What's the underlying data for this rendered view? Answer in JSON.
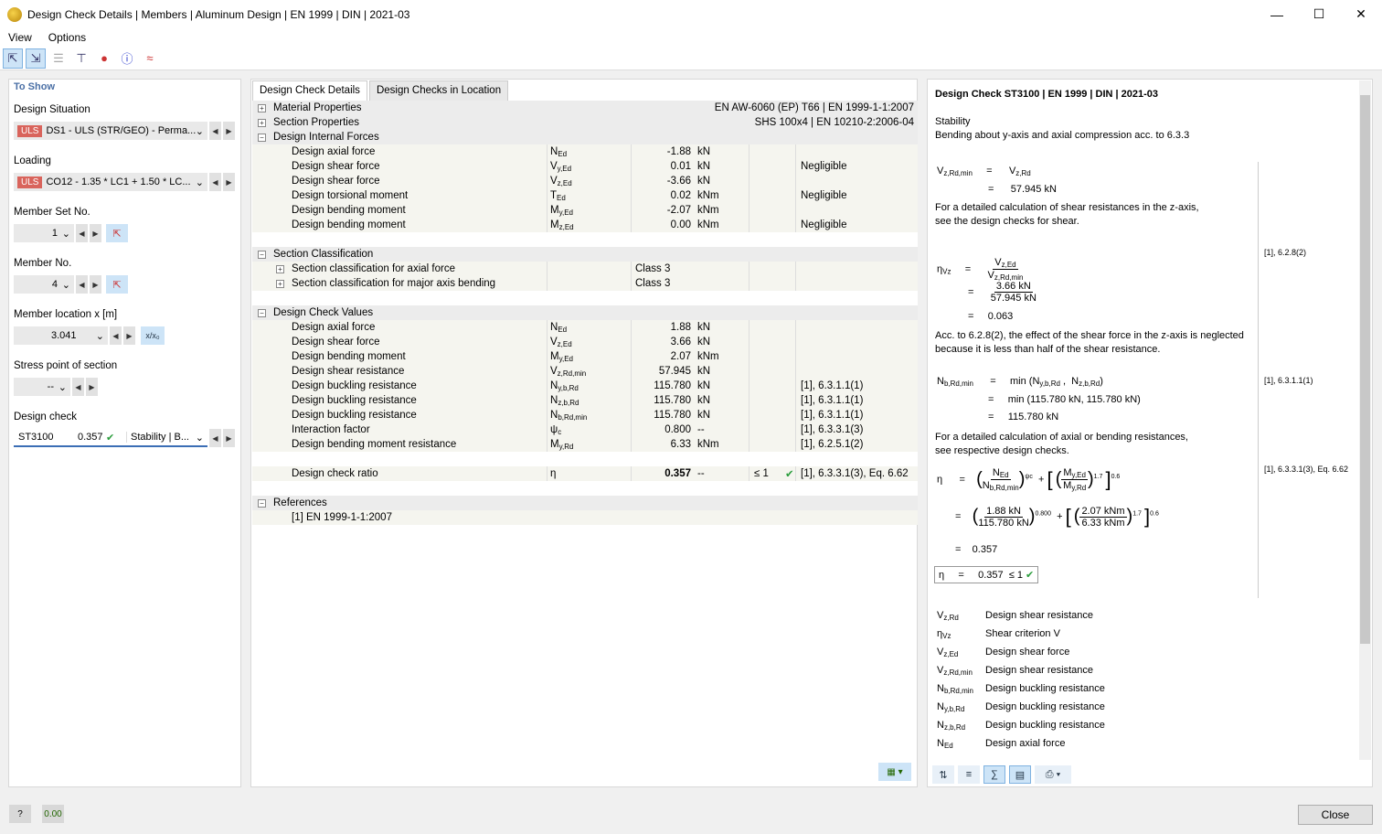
{
  "window": {
    "title": "Design Check Details | Members | Aluminum Design | EN 1999 | DIN | 2021-03"
  },
  "menu": [
    "View",
    "Options"
  ],
  "left": {
    "heading": "To Show",
    "design_situation": {
      "label": "Design Situation",
      "badge": "ULS",
      "value": "DS1 - ULS (STR/GEO) - Perma..."
    },
    "loading": {
      "label": "Loading",
      "badge": "ULS",
      "value": "CO12 - 1.35 * LC1 + 1.50 * LC..."
    },
    "member_set": {
      "label": "Member Set No.",
      "value": "1"
    },
    "member_no": {
      "label": "Member No.",
      "value": "4"
    },
    "location": {
      "label": "Member location x [m]",
      "value": "3.041",
      "btn": "x/x₀"
    },
    "stress_point": {
      "label": "Stress point of section",
      "value": "--"
    },
    "design_check": {
      "label": "Design check",
      "id": "ST3100",
      "ratio": "0.357",
      "type": "Stability | B..."
    }
  },
  "tabs": [
    "Design Check Details",
    "Design Checks in Location"
  ],
  "groups": {
    "material": {
      "name": "Material Properties",
      "value": "EN AW-6060 (EP) T66 | EN 1999-1-1:2007"
    },
    "section": {
      "name": "Section Properties",
      "value": "SHS 100x4 | EN 10210-2:2006-04"
    },
    "internal_forces": "Design Internal Forces",
    "classification": "Section Classification",
    "check_values": "Design Check Values",
    "references": "References"
  },
  "internal_forces": [
    {
      "name": "Design axial force",
      "sym": "N",
      "sub": "Ed",
      "val": "-1.88",
      "unit": "kN",
      "note": ""
    },
    {
      "name": "Design shear force",
      "sym": "V",
      "sub": "y,Ed",
      "val": "0.01",
      "unit": "kN",
      "note": "Negligible"
    },
    {
      "name": "Design shear force",
      "sym": "V",
      "sub": "z,Ed",
      "val": "-3.66",
      "unit": "kN",
      "note": ""
    },
    {
      "name": "Design torsional moment",
      "sym": "T",
      "sub": "Ed",
      "val": "0.02",
      "unit": "kNm",
      "note": "Negligible"
    },
    {
      "name": "Design bending moment",
      "sym": "M",
      "sub": "y,Ed",
      "val": "-2.07",
      "unit": "kNm",
      "note": ""
    },
    {
      "name": "Design bending moment",
      "sym": "M",
      "sub": "z,Ed",
      "val": "0.00",
      "unit": "kNm",
      "note": "Negligible"
    }
  ],
  "classification": [
    {
      "name": "Section classification for axial force",
      "val": "Class 3"
    },
    {
      "name": "Section classification for major axis bending",
      "val": "Class 3"
    }
  ],
  "check_values": [
    {
      "name": "Design axial force",
      "sym": "N",
      "sub": "Ed",
      "val": "1.88",
      "unit": "kN",
      "ref": ""
    },
    {
      "name": "Design shear force",
      "sym": "V",
      "sub": "z,Ed",
      "val": "3.66",
      "unit": "kN",
      "ref": ""
    },
    {
      "name": "Design bending moment",
      "sym": "M",
      "sub": "y,Ed",
      "val": "2.07",
      "unit": "kNm",
      "ref": ""
    },
    {
      "name": "Design shear resistance",
      "sym": "V",
      "sub": "z,Rd,min",
      "val": "57.945",
      "unit": "kN",
      "ref": ""
    },
    {
      "name": "Design buckling resistance",
      "sym": "N",
      "sub": "y,b,Rd",
      "val": "115.780",
      "unit": "kN",
      "ref": "[1], 6.3.1.1(1)"
    },
    {
      "name": "Design buckling resistance",
      "sym": "N",
      "sub": "z,b,Rd",
      "val": "115.780",
      "unit": "kN",
      "ref": "[1], 6.3.1.1(1)"
    },
    {
      "name": "Design buckling resistance",
      "sym": "N",
      "sub": "b,Rd,min",
      "val": "115.780",
      "unit": "kN",
      "ref": "[1], 6.3.1.1(1)"
    },
    {
      "name": "Interaction factor",
      "sym": "ψ",
      "sub": "c",
      "val": "0.800",
      "unit": "--",
      "ref": "[1], 6.3.3.1(3)"
    },
    {
      "name": "Design bending moment resistance",
      "sym": "M",
      "sub": "y,Rd",
      "val": "6.33",
      "unit": "kNm",
      "ref": "[1], 6.2.5.1(2)"
    }
  ],
  "ratio": {
    "name": "Design check ratio",
    "sym": "η",
    "val": "0.357",
    "unit": "--",
    "cmp": "≤ 1",
    "ref": "[1], 6.3.3.1(3), Eq. 6.62"
  },
  "reference": "[1]  EN 1999-1-1:2007",
  "right": {
    "title": "Design Check ST3100 | EN 1999 | DIN | 2021-03",
    "l1": "Stability",
    "l2": "Bending about y-axis and axial compression acc. to 6.3.3",
    "v_val": "57.945 kN",
    "p1a": "For a detailed calculation of shear resistances in the z-axis,",
    "p1b": "see the design checks for shear.",
    "ref1": "[1], 6.2.8(2)",
    "eta_num": "3.66 kN",
    "eta_den": "57.945 kN",
    "eta_val": "0.063",
    "p2a": "Acc. to 6.2.8(2), the effect of the shear force in the z-axis is neglected",
    "p2b": "because it is less than half of the shear resistance.",
    "ref2": "[1], 6.3.1.1(1)",
    "nb_line2": "min (115.780 kN,  115.780 kN)",
    "nb_val": "115.780 kN",
    "p3a": "For a detailed calculation of axial or bending resistances,",
    "p3b": "see respective design checks.",
    "ref3": "[1], 6.3.3.1(3), Eq. 6.62",
    "f_n_num": "1.88 kN",
    "f_n_den": "115.780 kN",
    "f_exp1": "0.800",
    "f_m_num": "2.07 kNm",
    "f_m_den": "6.33 kNm",
    "f_exp2": "1.7",
    "f_exp3": "0.6",
    "result": "0.357",
    "box": "0.357",
    "legend": [
      {
        "sym": "V",
        "sub": "z,Rd",
        "text": "Design shear resistance"
      },
      {
        "sym": "η",
        "sub": "Vz",
        "text": "Shear criterion V"
      },
      {
        "sym": "V",
        "sub": "z,Ed",
        "text": "Design shear force"
      },
      {
        "sym": "V",
        "sub": "z,Rd,min",
        "text": "Design shear resistance"
      },
      {
        "sym": "N",
        "sub": "b,Rd,min",
        "text": "Design buckling resistance"
      },
      {
        "sym": "N",
        "sub": "y,b,Rd",
        "text": "Design buckling resistance"
      },
      {
        "sym": "N",
        "sub": "z,b,Rd",
        "text": "Design buckling resistance"
      },
      {
        "sym": "N",
        "sub": "Ed",
        "text": "Design axial force"
      }
    ]
  },
  "close": "Close"
}
